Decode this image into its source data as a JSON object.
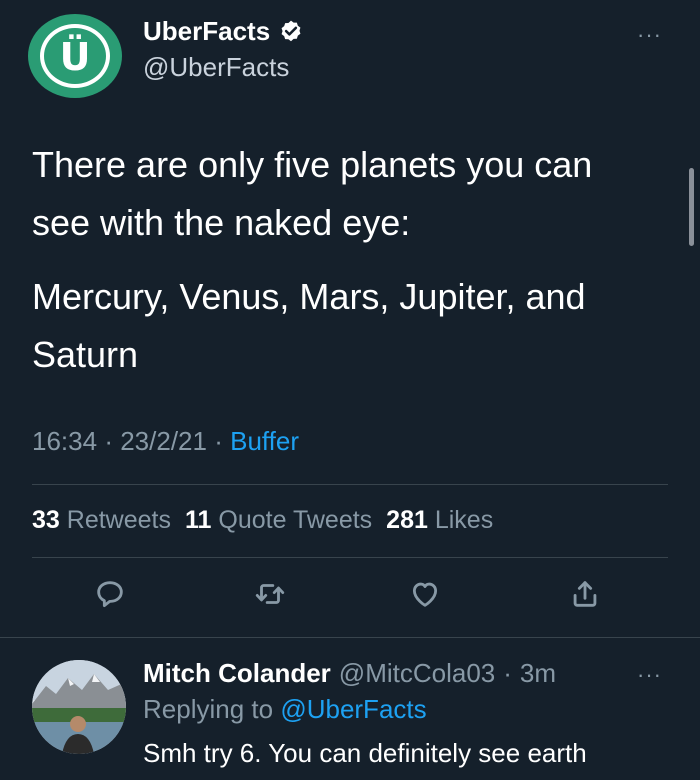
{
  "tweet": {
    "author": {
      "name": "UberFacts",
      "handle": "@UberFacts",
      "avatar_letter": "Ü",
      "verified": true
    },
    "paragraphs": [
      "There are only five planets you can see with the naked eye:",
      "Mercury, Venus, Mars, Jupiter, and Saturn"
    ],
    "time": "16:34",
    "date": "23/2/21",
    "separator": "·",
    "source": "Buffer",
    "stats": {
      "retweets_count": "33",
      "retweets_label": "Retweets",
      "quotes_count": "11",
      "quotes_label": "Quote Tweets",
      "likes_count": "281",
      "likes_label": "Likes"
    },
    "more_label": "···"
  },
  "reply": {
    "author_name": "Mitch Colander",
    "handle": "@MitcCola03",
    "separator": "·",
    "time": "3m",
    "replying_prefix": "Replying to",
    "replying_to": "@UberFacts",
    "text": "Smh try 6. You can definitely see earth",
    "more_label": "···"
  },
  "icons": {
    "reply": "reply-icon",
    "retweet": "retweet-icon",
    "like": "heart-icon",
    "share": "share-icon"
  },
  "colors": {
    "background": "#15202b",
    "link": "#1da1f2",
    "secondary_text": "#8899a6",
    "divider": "#38444d",
    "brand_green": "#2a9c74"
  }
}
